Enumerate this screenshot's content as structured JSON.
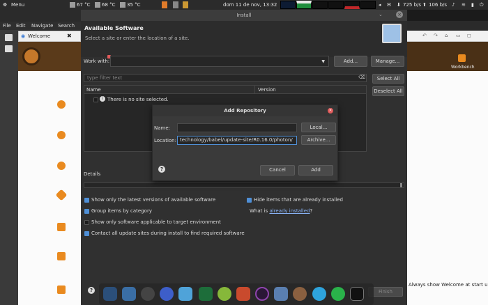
{
  "panel": {
    "menu": "Menu",
    "temp1": "67 °C",
    "temp2": "68 °C",
    "temp3": "35 °C",
    "datetime": "dom 11 de nov, 13:32",
    "net_down": "725 b/s",
    "net_up": "106 b/s"
  },
  "eclipse": {
    "menu": [
      "File",
      "Edit",
      "Navigate",
      "Search"
    ],
    "welcome_tab": "Welcome",
    "workbench": "Workbench",
    "always_show": "Always show Welcome at start up"
  },
  "install": {
    "window_title": "Install",
    "heading": "Available Software",
    "subheading": "Select a site or enter the location of a site.",
    "work_with_label": "Work with:",
    "add_button": "Add...",
    "manage_button": "Manage...",
    "filter_placeholder": "type filter text",
    "select_all": "Select All",
    "deselect_all": "Deselect All",
    "col_name": "Name",
    "col_version": "Version",
    "no_site": "There is no site selected.",
    "details": "Details",
    "opt_latest": "Show only the latest versions of available software",
    "opt_group": "Group items by category",
    "opt_target": "Show only software applicable to target environment",
    "opt_contact": "Contact all update sites during install to find required software",
    "opt_hide": "Hide items that are already installed",
    "what_is": "What is ",
    "already_installed": "already installed",
    "question_mark": "?",
    "finish": "Finish"
  },
  "add_repository": {
    "title": "Add Repository",
    "name_label": "Name:",
    "name_value": "",
    "local_button": "Local...",
    "location_label": "Location:",
    "location_value": "technology/babel/update-site/R0.16.0/photon/",
    "archive_button": "Archive...",
    "cancel_button": "Cancel",
    "add_button": "Add"
  },
  "colors": {
    "accent": "#4f8fd6",
    "link": "#8ab4f8",
    "close": "#e05a5a"
  }
}
